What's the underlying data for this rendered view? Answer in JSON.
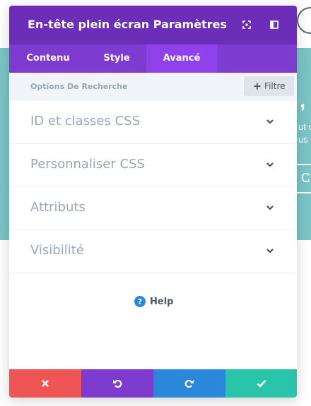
{
  "background": {
    "heading_fragment": ", P",
    "text_line_1": "ut c",
    "text_line_2": "us",
    "button_fragment": "Cl"
  },
  "modal": {
    "title": "En-tête plein écran Paramètres",
    "header_icons": [
      "fullscreen-icon",
      "sidebar-toggle-icon"
    ],
    "tabs": [
      {
        "label": "Contenu",
        "active": false
      },
      {
        "label": "Style",
        "active": false
      },
      {
        "label": "Avancé",
        "active": true
      }
    ],
    "search": {
      "placeholder": "Options De Recherche"
    },
    "filter": {
      "label": "Filtre"
    },
    "sections": [
      {
        "label": "ID et classes CSS"
      },
      {
        "label": "Personnaliser CSS"
      },
      {
        "label": "Attributs"
      },
      {
        "label": "Visibilité"
      }
    ],
    "help": {
      "label": "Help"
    },
    "footer_buttons": [
      {
        "icon": "close-icon",
        "color": "#ef5555"
      },
      {
        "icon": "undo-icon",
        "color": "#7e3bd0"
      },
      {
        "icon": "redo-icon",
        "color": "#2b87da"
      },
      {
        "icon": "check-icon",
        "color": "#29c4a9"
      }
    ]
  },
  "colors": {
    "header": "#6c2eb9",
    "tab_bar": "#7e3bd0",
    "tab_active": "#8f42ec",
    "background_band": "#7cc4c6"
  }
}
